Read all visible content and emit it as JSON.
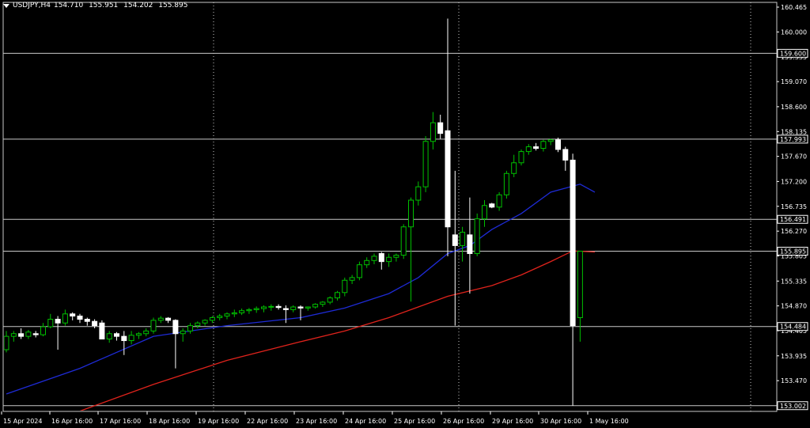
{
  "header": {
    "symbol": "USDJPY,H4",
    "open": "154.710",
    "high": "155.951",
    "low": "154.202",
    "close": "155.895"
  },
  "colors": {
    "background": "#000000",
    "bull_candle": "#00c000",
    "bear_candle": "#ffffff",
    "ma_fast": "#1e2bd6",
    "ma_slow": "#e0231c",
    "level_line": "#c8c8c8",
    "grid": "#c8c8c8",
    "axis_text": "#ffffff"
  },
  "chart_data": {
    "type": "candlestick",
    "timeframe": "H4",
    "grid": false,
    "ylim": [
      152.95,
      160.6
    ],
    "price_ticks": [
      "160.465",
      "160.000",
      "159.535",
      "159.070",
      "158.600",
      "158.135",
      "157.670",
      "157.200",
      "156.735",
      "156.270",
      "155.805",
      "155.335",
      "154.870",
      "154.405",
      "153.935",
      "153.470"
    ],
    "time_labels": [
      "15 Apr 2024",
      "16 Apr 16:00",
      "17 Apr 16:00",
      "18 Apr 16:00",
      "19 Apr 16:00",
      "22 Apr 16:00",
      "23 Apr 16:00",
      "24 Apr 16:00",
      "25 Apr 16:00",
      "26 Apr 16:00",
      "29 Apr 16:00",
      "30 Apr 16:00",
      "1 May 16:00"
    ],
    "horizontal_levels": [
      "159.600",
      "157.993",
      "156.491",
      "155.895",
      "154.484",
      "153.002"
    ],
    "period_separators": [
      "19 Apr 16:00",
      "26 Apr 16:00",
      "1 May 16:00"
    ],
    "candles": [
      [
        154.05,
        154.4,
        154.0,
        154.3
      ],
      [
        154.3,
        154.4,
        154.2,
        154.35
      ],
      [
        154.35,
        154.45,
        154.25,
        154.3
      ],
      [
        154.3,
        154.42,
        154.25,
        154.38
      ],
      [
        154.35,
        154.4,
        154.28,
        154.33
      ],
      [
        154.33,
        154.55,
        154.3,
        154.48
      ],
      [
        154.48,
        154.72,
        154.45,
        154.62
      ],
      [
        154.62,
        154.68,
        154.05,
        154.55
      ],
      [
        154.55,
        154.8,
        154.5,
        154.72
      ],
      [
        154.72,
        154.75,
        154.6,
        154.68
      ],
      [
        154.68,
        154.72,
        154.55,
        154.62
      ],
      [
        154.62,
        154.65,
        154.5,
        154.58
      ],
      [
        154.58,
        154.62,
        154.45,
        154.5
      ],
      [
        154.55,
        154.6,
        154.25,
        154.25
      ],
      [
        154.25,
        154.4,
        154.18,
        154.35
      ],
      [
        154.35,
        154.38,
        154.22,
        154.3
      ],
      [
        154.3,
        154.4,
        153.95,
        154.22
      ],
      [
        154.22,
        154.4,
        154.15,
        154.32
      ],
      [
        154.32,
        154.38,
        154.25,
        154.35
      ],
      [
        154.35,
        154.45,
        154.3,
        154.4
      ],
      [
        154.4,
        154.65,
        154.35,
        154.6
      ],
      [
        154.6,
        154.68,
        154.55,
        154.64
      ],
      [
        154.64,
        154.66,
        154.55,
        154.6
      ],
      [
        154.6,
        154.62,
        153.7,
        154.35
      ],
      [
        154.35,
        154.45,
        154.2,
        154.4
      ],
      [
        154.4,
        154.55,
        154.35,
        154.5
      ],
      [
        154.5,
        154.58,
        154.45,
        154.55
      ],
      [
        154.55,
        154.62,
        154.5,
        154.6
      ],
      [
        154.6,
        154.68,
        154.55,
        154.65
      ],
      [
        154.65,
        154.72,
        154.6,
        154.68
      ],
      [
        154.68,
        154.75,
        154.62,
        154.72
      ],
      [
        154.72,
        154.8,
        154.66,
        154.74
      ],
      [
        154.74,
        154.82,
        154.7,
        154.78
      ],
      [
        154.78,
        154.83,
        154.72,
        154.8
      ],
      [
        154.8,
        154.86,
        154.74,
        154.82
      ],
      [
        154.82,
        154.88,
        154.75,
        154.85
      ],
      [
        154.85,
        154.9,
        154.78,
        154.86
      ],
      [
        154.86,
        154.9,
        154.8,
        154.84
      ],
      [
        154.82,
        154.88,
        154.55,
        154.8
      ],
      [
        154.8,
        154.88,
        154.75,
        154.85
      ],
      [
        154.85,
        154.88,
        154.6,
        154.83
      ],
      [
        154.83,
        154.86,
        154.78,
        154.85
      ],
      [
        154.85,
        154.92,
        154.82,
        154.9
      ],
      [
        154.9,
        154.96,
        154.85,
        154.94
      ],
      [
        154.94,
        155.05,
        154.9,
        155.02
      ],
      [
        155.02,
        155.15,
        154.97,
        155.12
      ],
      [
        155.12,
        155.4,
        155.05,
        155.35
      ],
      [
        155.35,
        155.45,
        155.28,
        155.4
      ],
      [
        155.4,
        155.7,
        155.35,
        155.64
      ],
      [
        155.64,
        155.78,
        155.58,
        155.72
      ],
      [
        155.72,
        155.85,
        155.65,
        155.8
      ],
      [
        155.85,
        155.88,
        155.55,
        155.7
      ],
      [
        155.7,
        155.85,
        155.6,
        155.78
      ],
      [
        155.78,
        155.85,
        155.7,
        155.82
      ],
      [
        155.82,
        156.4,
        155.75,
        156.35
      ],
      [
        156.35,
        156.9,
        154.95,
        156.85
      ],
      [
        156.85,
        157.2,
        156.75,
        157.1
      ],
      [
        157.1,
        158.05,
        157.0,
        157.95
      ],
      [
        157.95,
        158.5,
        157.8,
        158.3
      ],
      [
        158.3,
        158.45,
        158.0,
        158.1
      ],
      [
        158.15,
        160.25,
        155.8,
        156.35
      ],
      [
        156.2,
        157.4,
        154.5,
        156.0
      ],
      [
        156.0,
        156.35,
        155.7,
        156.25
      ],
      [
        156.2,
        156.9,
        155.1,
        155.85
      ],
      [
        155.85,
        156.6,
        155.8,
        156.5
      ],
      [
        156.5,
        156.85,
        156.35,
        156.75
      ],
      [
        156.78,
        156.8,
        156.7,
        156.72
      ],
      [
        156.72,
        157.0,
        156.65,
        156.95
      ],
      [
        156.95,
        157.4,
        156.88,
        157.35
      ],
      [
        157.35,
        157.7,
        157.28,
        157.55
      ],
      [
        157.55,
        157.8,
        157.5,
        157.76
      ],
      [
        157.76,
        157.9,
        157.7,
        157.85
      ],
      [
        157.85,
        157.92,
        157.78,
        157.82
      ],
      [
        157.82,
        157.98,
        157.76,
        157.95
      ],
      [
        157.95,
        158.0,
        157.88,
        157.98
      ],
      [
        157.98,
        158.02,
        157.75,
        157.8
      ],
      [
        157.8,
        157.85,
        157.4,
        157.6
      ],
      [
        157.6,
        157.72,
        153.0,
        154.5
      ],
      [
        154.65,
        155.9,
        154.2,
        155.895
      ]
    ],
    "ma_fast": [
      [
        0,
        153.22
      ],
      [
        10,
        153.7
      ],
      [
        20,
        154.3
      ],
      [
        30,
        154.5
      ],
      [
        40,
        154.65
      ],
      [
        46,
        154.83
      ],
      [
        52,
        155.1
      ],
      [
        56,
        155.4
      ],
      [
        60,
        155.85
      ],
      [
        63,
        156.0
      ],
      [
        66,
        156.3
      ],
      [
        70,
        156.6
      ],
      [
        74,
        157.0
      ],
      [
        78,
        157.15
      ],
      [
        80,
        157.0
      ]
    ],
    "ma_slow": [
      [
        10,
        152.9
      ],
      [
        20,
        153.4
      ],
      [
        30,
        153.85
      ],
      [
        40,
        154.2
      ],
      [
        46,
        154.4
      ],
      [
        52,
        154.65
      ],
      [
        56,
        154.85
      ],
      [
        60,
        155.05
      ],
      [
        63,
        155.15
      ],
      [
        66,
        155.25
      ],
      [
        70,
        155.45
      ],
      [
        74,
        155.7
      ],
      [
        77,
        155.9
      ],
      [
        80,
        155.88
      ]
    ]
  }
}
